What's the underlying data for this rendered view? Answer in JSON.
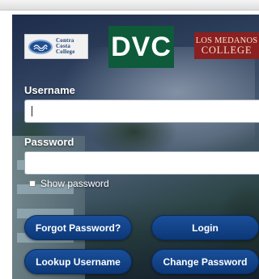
{
  "logos": {
    "contra_costa": [
      "Contra",
      "Costa",
      "College"
    ],
    "dvc": "DVC",
    "los_medanos": [
      "LOS MEDANOS",
      "COLLEGE"
    ]
  },
  "form": {
    "username_label": "Username",
    "username_value": "",
    "password_label": "Password",
    "password_value": "",
    "show_password_label": "Show password",
    "show_password_checked": false
  },
  "buttons": {
    "forgot_password": "Forgot Password?",
    "login": "Login",
    "lookup_username": "Lookup Username",
    "change_password": "Change Password"
  },
  "colors": {
    "button_blue": "#0c3878",
    "dvc_green": "#0e5a3b",
    "lmc_red": "#8c1f20"
  }
}
